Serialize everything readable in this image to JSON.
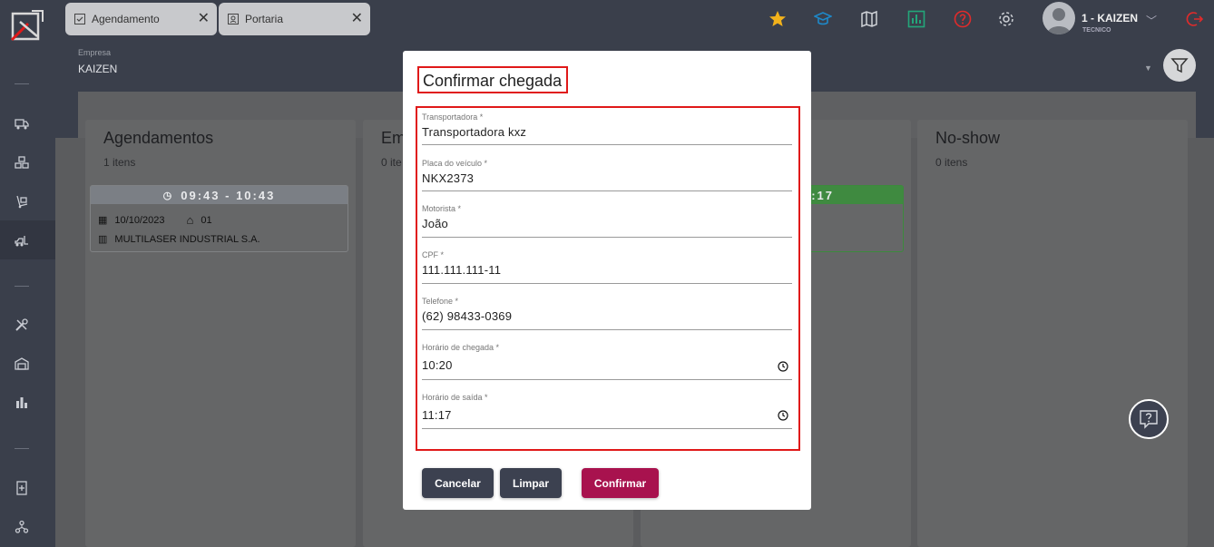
{
  "tabs": [
    {
      "label": "Agendamento"
    },
    {
      "label": "Portaria"
    }
  ],
  "user": {
    "name": "1 - KAIZEN",
    "role": "TECNICO"
  },
  "empresa": {
    "label": "Empresa",
    "value": "KAIZEN"
  },
  "columns": [
    {
      "title": "Agendamentos",
      "count": "1 itens"
    },
    {
      "title": "Em",
      "count": "0 ite"
    },
    {
      "title": "",
      "count": ""
    },
    {
      "title": "No-show",
      "count": "0 itens"
    }
  ],
  "card1": {
    "time": "09:43 - 10:43",
    "date": "10/10/2023",
    "dock": "01",
    "company": "MULTILASER INDUSTRIAL S.A."
  },
  "card2": {
    "time": ":17"
  },
  "modal": {
    "title": "Confirmar chegada",
    "fields": [
      {
        "label": "Transportadora *",
        "value": "Transportadora kxz"
      },
      {
        "label": "Placa do veículo *",
        "value": "NKX2373"
      },
      {
        "label": "Motorista *",
        "value": "João"
      },
      {
        "label": "CPF *",
        "value": "111.111.111-11"
      },
      {
        "label": "Telefone *",
        "value": "(62) 98433-0369"
      },
      {
        "label": "Horário de chegada *",
        "value": "10:20"
      },
      {
        "label": "Horário de saída *",
        "value": "11:17"
      }
    ],
    "buttons": {
      "cancel": "Cancelar",
      "clear": "Limpar",
      "confirm": "Confirmar"
    }
  },
  "colors": {
    "accent": "#a8124e",
    "highlight": "#e01919",
    "dark": "#3c4150"
  }
}
